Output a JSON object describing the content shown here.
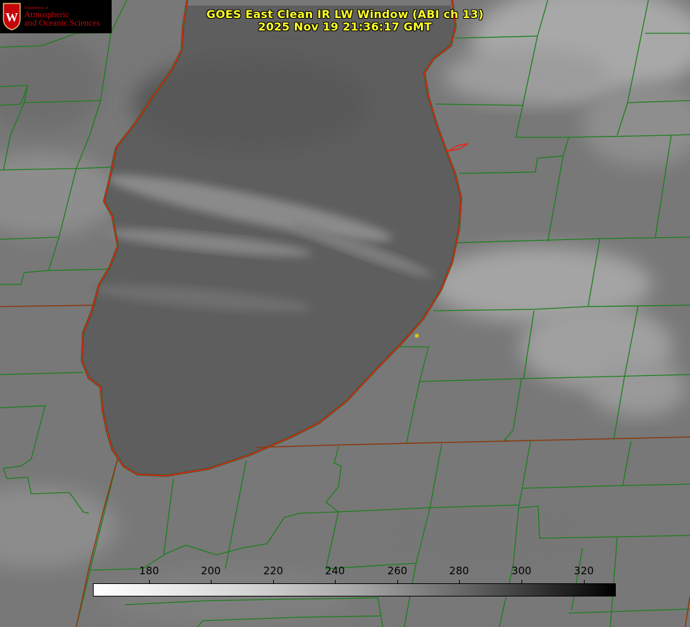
{
  "header": {
    "title_line1": "GOES East Clean IR LW Window (ABI ch 13)",
    "title_line2": "2025 Nov 19 21:36:17 GMT"
  },
  "logo": {
    "department": "Department of",
    "line1": "Atmospheric",
    "line2": "and Oceanic Sciences",
    "crest_letter": "W",
    "color": "#c5050c"
  },
  "colorbar": {
    "ticks": [
      "180",
      "200",
      "220",
      "240",
      "260",
      "280",
      "300",
      "320"
    ],
    "min_color": "#ffffff",
    "max_color": "#000000"
  },
  "map": {
    "county_line_color": "#1a7f1a",
    "coastline_color": "#e8231a",
    "state_line_color": "#8a3a10",
    "marker_color": "#d4c21a",
    "title_color": "#ffff2a"
  }
}
